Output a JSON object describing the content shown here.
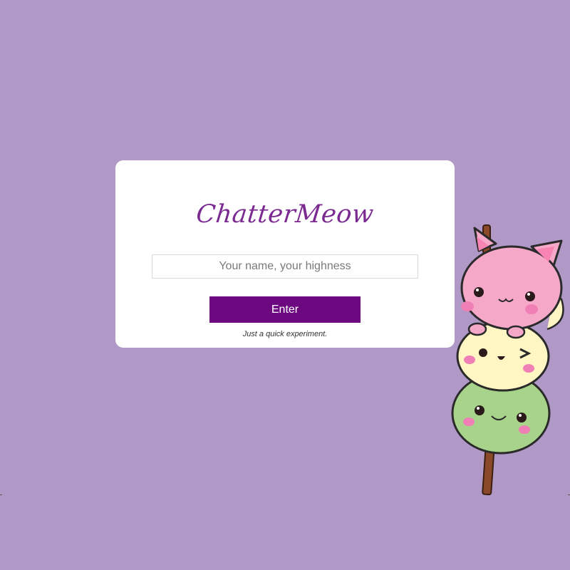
{
  "app": {
    "logo_text": "ChatterMeow",
    "tagline": "Just a quick experiment."
  },
  "login": {
    "name_placeholder": "Your name, your highness",
    "name_value": "",
    "enter_label": "Enter"
  },
  "colors": {
    "page_background": "#b199c7",
    "card_background": "#ffffff",
    "brand_purple": "#7b2a92",
    "button_background": "#6d0980",
    "button_text": "#ffffff"
  },
  "mascot": {
    "icon": "dango-cats-icon"
  }
}
